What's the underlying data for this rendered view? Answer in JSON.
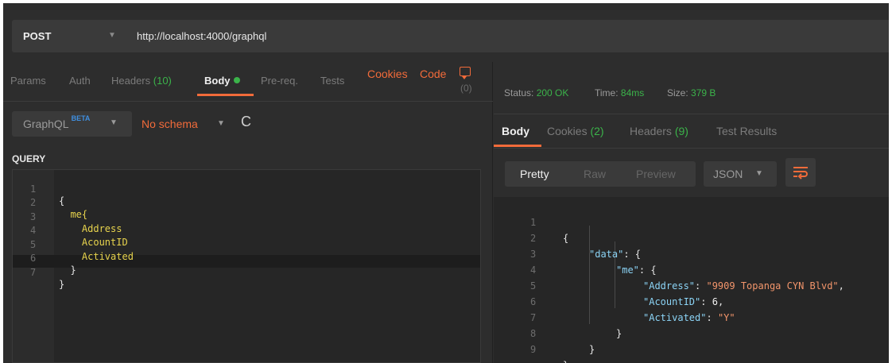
{
  "request": {
    "method": "POST",
    "url": "http://localhost:4000/graphql"
  },
  "request_tabs": {
    "params": "Params",
    "auth": "Auth",
    "headers": "Headers",
    "headers_count": "(10)",
    "body": "Body",
    "prereq": "Pre-req.",
    "tests": "Tests",
    "cookies": "Cookies",
    "code": "Code",
    "comments_count": "(0)"
  },
  "body_mode": {
    "type": "GraphQL",
    "badge": "BETA",
    "schema": "No schema",
    "refresh_icon": "refresh-icon"
  },
  "query_editor": {
    "label": "QUERY",
    "lines": [
      {
        "num": "1",
        "text": "{"
      },
      {
        "num": "2",
        "text": "  me{"
      },
      {
        "num": "3",
        "text": "    Address"
      },
      {
        "num": "4",
        "text": "    AcountID"
      },
      {
        "num": "5",
        "text": "    Activated"
      },
      {
        "num": "6",
        "text": "  }"
      },
      {
        "num": "7",
        "text": "}"
      }
    ]
  },
  "response_status": {
    "status_label": "Status:",
    "status_value": "200 OK",
    "time_label": "Time:",
    "time_value": "84ms",
    "size_label": "Size:",
    "size_value": "379 B"
  },
  "response_tabs": {
    "body": "Body",
    "cookies": "Cookies",
    "cookies_count": "(2)",
    "headers": "Headers",
    "headers_count": "(9)",
    "test_results": "Test Results"
  },
  "response_view": {
    "pretty": "Pretty",
    "raw": "Raw",
    "preview": "Preview",
    "format": "JSON"
  },
  "response_body": {
    "line_numbers": [
      "1",
      "2",
      "3",
      "4",
      "5",
      "6",
      "7",
      "8",
      "9"
    ],
    "open_brace": "{",
    "data_key": "\"data\"",
    "me_key": "\"me\"",
    "address_key": "\"Address\"",
    "address_value": "\"9909 Topanga CYN Blvd\"",
    "acountid_key": "\"AcountID\"",
    "acountid_value": "6",
    "activated_key": "\"Activated\"",
    "activated_value": "\"Y\"",
    "close_brace": "}"
  },
  "colors": {
    "accent": "#f26b3a",
    "success": "#3bb34a",
    "background": "#2d2d2d",
    "json_key": "#8bd3f5",
    "json_string": "#f2956b",
    "graphql_field": "#e8d44d"
  }
}
